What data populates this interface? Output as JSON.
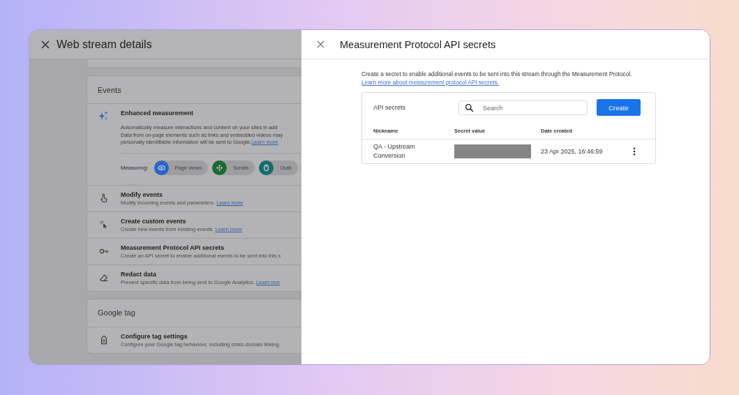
{
  "background_page": {
    "title": "Web stream details",
    "events_card": {
      "heading": "Events",
      "enhanced_measurement": {
        "title": "Enhanced measurement",
        "lines": [
          "Automatically measure interactions and content on your sites in add",
          "Data from on-page elements such as links and embedded videos may",
          "personally identifiable information will be sent to Google."
        ],
        "link": "Learn more",
        "measuring_label": "Measuring:",
        "chips": [
          {
            "label": "Page views",
            "color": "#2c64c6"
          },
          {
            "label": "Scrolls",
            "color": "#1d6b2e"
          },
          {
            "label": "Outb",
            "color": "#1b6a6c"
          }
        ]
      },
      "items": [
        {
          "title": "Modify events",
          "description": "Modify incoming events and parameters.",
          "link": "Learn more"
        },
        {
          "title": "Create custom events",
          "description": "Create new events from existing events.",
          "link": "Learn more"
        },
        {
          "title": "Measurement Protocol API secrets",
          "description": "Create an API secret to enable additional events to be sent into this s"
        },
        {
          "title": "Redact data",
          "description": "Prevent specific data from being sent to Google Analytics.",
          "link": "Learn mor"
        }
      ]
    },
    "google_tag_card": {
      "heading": "Google tag",
      "items": [
        {
          "title": "Configure tag settings",
          "description": "Configure your Google tag behaviour, including cross-domain linking"
        }
      ]
    }
  },
  "panel": {
    "title": "Measurement Protocol API secrets",
    "intro": "Create a secret to enable additional events to be sent into this stream through the Measurement Protocol.",
    "intro_link": "Learn more about measurement protocol API secrets.",
    "table": {
      "title": "API secrets",
      "search": {
        "placeholder": "Search"
      },
      "create_button": "Create",
      "columns": [
        "Nickname",
        "Secret value",
        "Date created"
      ],
      "rows": [
        {
          "nickname": "QA - Upstream Conversion",
          "date": "23 Apr 2025, 16:46:59"
        }
      ]
    }
  }
}
